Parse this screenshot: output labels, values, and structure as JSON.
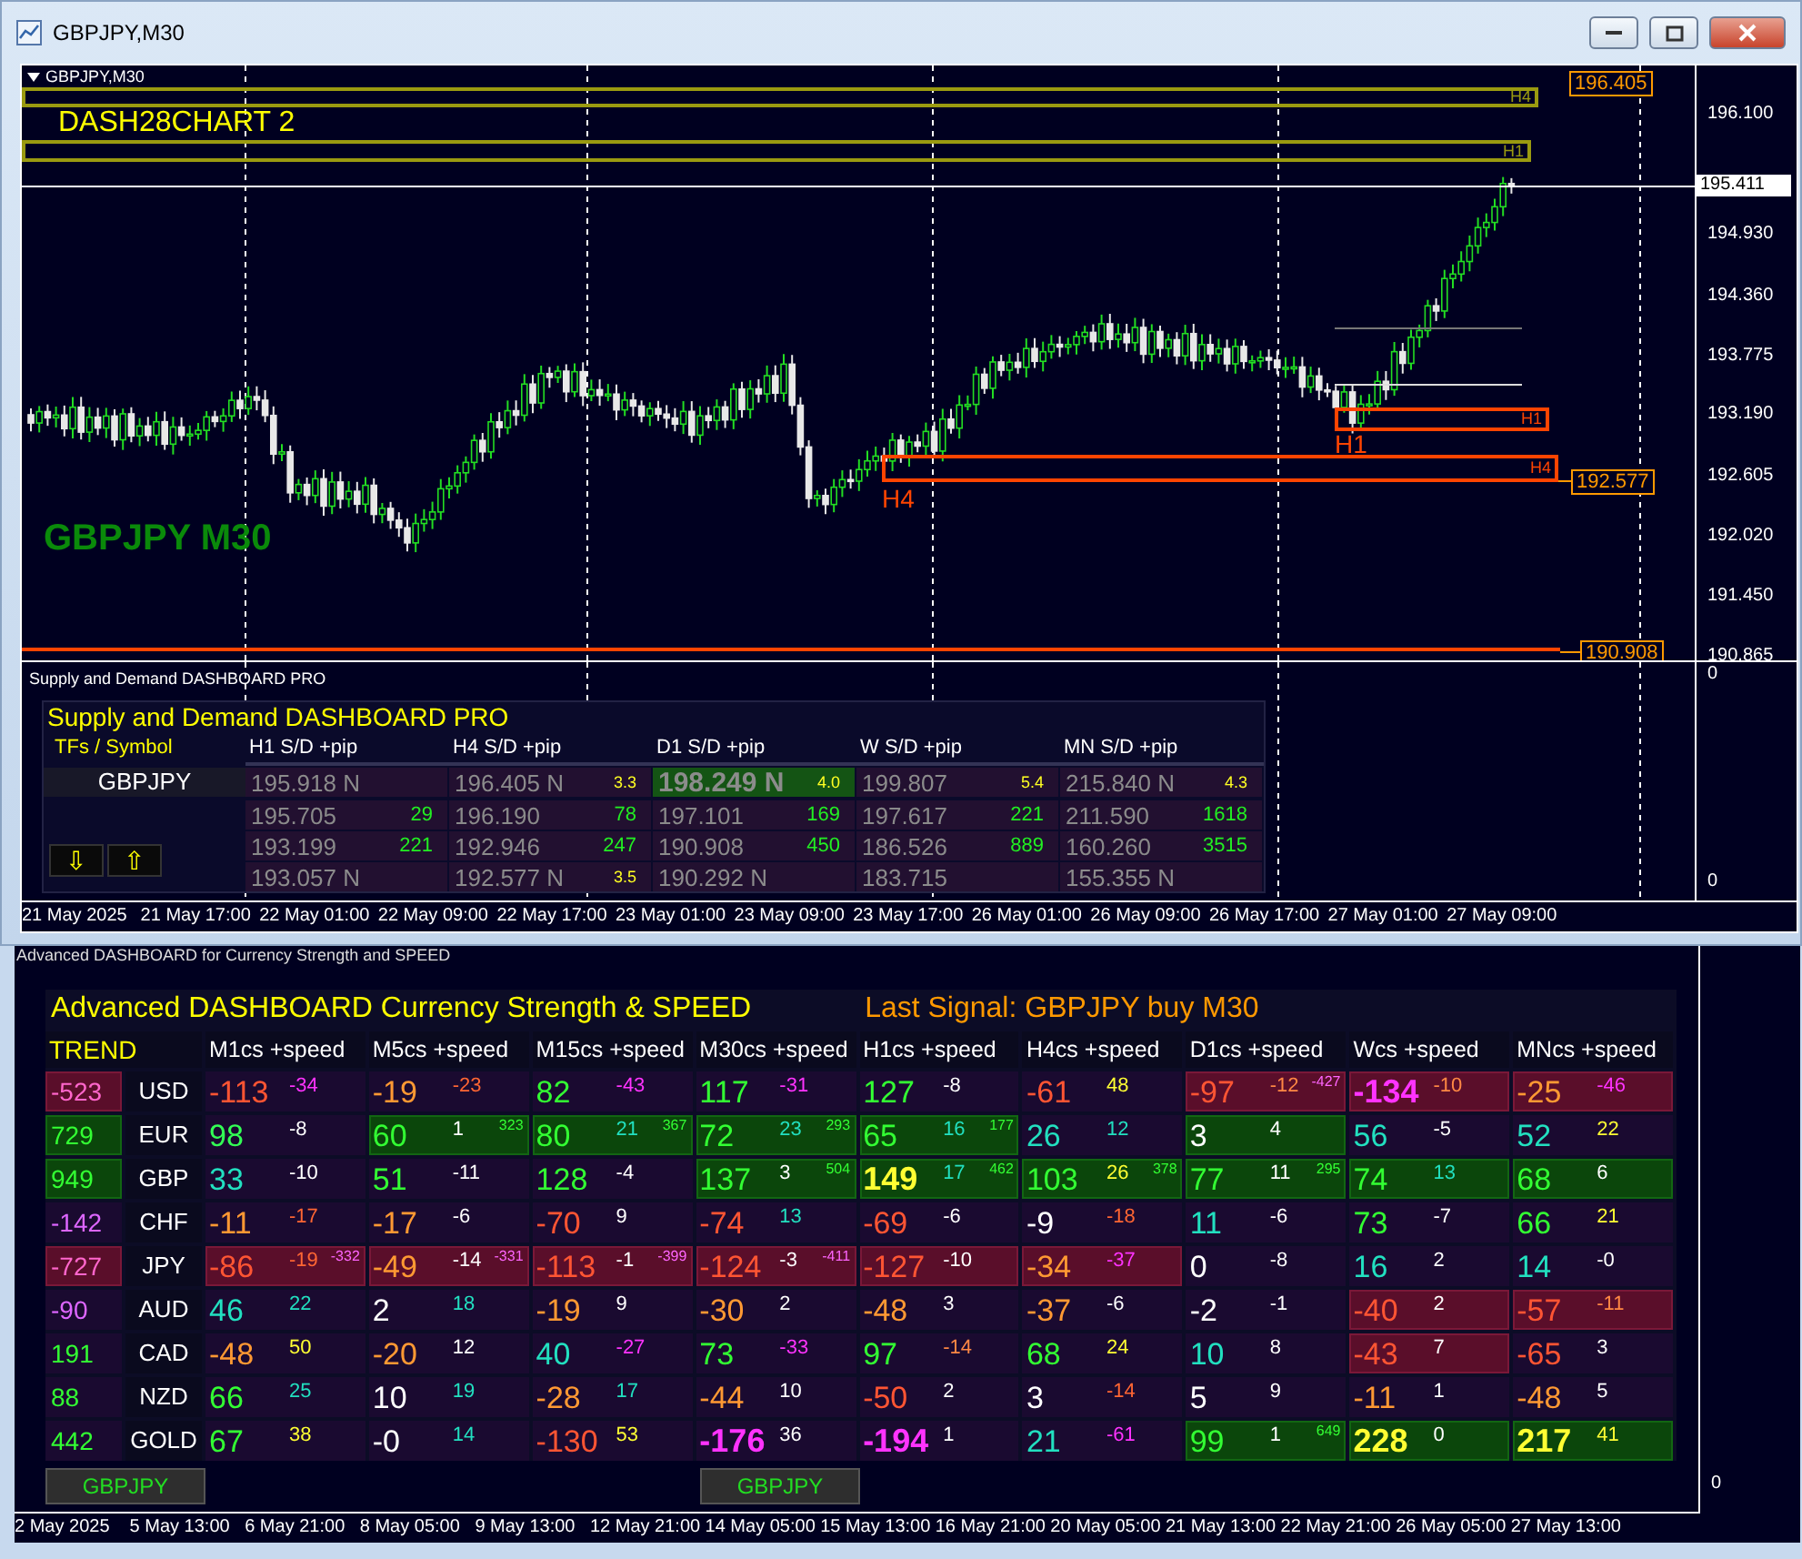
{
  "window": {
    "title": "GBPJPY,M30"
  },
  "chart": {
    "header": "GBPJPY,M30",
    "indicator_label": "DASH28CHART 2",
    "symbol_label": "GBPJPY M30",
    "zone_labels": [
      {
        "text": "H4",
        "kind": "olive"
      },
      {
        "text": "H1",
        "kind": "olive"
      },
      {
        "text": "H1",
        "kind": "orange"
      },
      {
        "text": "H4",
        "kind": "orange"
      },
      {
        "text": "H1",
        "kind": "orange-large"
      },
      {
        "text": "H4",
        "kind": "orange-large"
      }
    ],
    "price_tags": [
      "196.405",
      "192.577",
      "190.908"
    ],
    "current_price": "195.411",
    "price_axis": [
      "196.100",
      "194.930",
      "194.360",
      "193.775",
      "193.190",
      "192.605",
      "192.020",
      "191.450",
      "190.865"
    ],
    "subpane_axis": [
      "0",
      "0"
    ],
    "time_axis": [
      "21 May 2025",
      "21 May 17:00",
      "22 May 01:00",
      "22 May 09:00",
      "22 May 17:00",
      "23 May 01:00",
      "23 May 09:00",
      "23 May 17:00",
      "26 May 01:00",
      "26 May 09:00",
      "26 May 17:00",
      "27 May 01:00",
      "27 May 09:00"
    ]
  },
  "sd_dashboard": {
    "pane_title": "Supply and Demand DASHBOARD PRO",
    "title": "Supply and Demand DASHBOARD PRO",
    "symbol_header": "TFs / Symbol",
    "symbol": "GBPJPY",
    "arrows": [
      "⇩",
      "⇧"
    ],
    "columns": [
      "H1 S/D +pip",
      "H4 S/D +pip",
      "D1 S/D +pip",
      "W S/D +pip",
      "MN S/D +pip"
    ],
    "rows": [
      [
        {
          "price": "195.918 N",
          "kind": "level",
          "highlighted": false
        },
        {
          "price": "196.405 N",
          "note": "3.3",
          "kind": "level",
          "highlighted": false
        },
        {
          "price": "198.249 N",
          "note": "4.0",
          "kind": "level",
          "highlighted": true
        },
        {
          "price": "199.807",
          "note": "5.4",
          "kind": "level",
          "highlighted": false
        },
        {
          "price": "215.840 N",
          "note": "4.3",
          "kind": "level",
          "highlighted": false
        }
      ],
      [
        {
          "price": "195.705",
          "note": "29",
          "kind": "pips",
          "highlighted": false
        },
        {
          "price": "196.190",
          "note": "78",
          "kind": "pips",
          "highlighted": false
        },
        {
          "price": "197.101",
          "note": "169",
          "kind": "pips",
          "highlighted": false
        },
        {
          "price": "197.617",
          "note": "221",
          "kind": "pips",
          "highlighted": false
        },
        {
          "price": "211.590",
          "note": "1618",
          "kind": "pips",
          "highlighted": false
        }
      ],
      [
        {
          "price": "193.199",
          "note": "221",
          "kind": "pips",
          "highlighted": false
        },
        {
          "price": "192.946",
          "note": "247",
          "kind": "pips",
          "highlighted": false
        },
        {
          "price": "190.908",
          "note": "450",
          "kind": "pips",
          "highlighted": false
        },
        {
          "price": "186.526",
          "note": "889",
          "kind": "pips",
          "highlighted": false
        },
        {
          "price": "160.260",
          "note": "3515",
          "kind": "pips",
          "highlighted": false
        }
      ],
      [
        {
          "price": "193.057 N",
          "kind": "level",
          "highlighted": false
        },
        {
          "price": "192.577 N",
          "note": "3.5",
          "kind": "level",
          "highlighted": false
        },
        {
          "price": "190.292 N",
          "kind": "level",
          "highlighted": false
        },
        {
          "price": "183.715",
          "kind": "level",
          "highlighted": false
        },
        {
          "price": "155.355 N",
          "kind": "level",
          "highlighted": false
        }
      ]
    ]
  },
  "currency": {
    "pane_title": "Advanced DASHBOARD for Currency Strength and SPEED",
    "title": "Advanced  DASHBOARD Currency Strength & SPEED",
    "last_signal": "Last Signal: GBPJPY buy M30",
    "trend_header": "TREND",
    "columns": [
      "M1cs +speed",
      "M5cs +speed",
      "M15cs +speed",
      "M30cs +speed",
      "H1cs +speed",
      "H4cs +speed",
      "D1cs +speed",
      "Wcs +speed",
      "MNcs +speed"
    ],
    "rows": [
      {
        "kind": "down",
        "trend": {
          "text": "-523",
          "color": "#ff66cc"
        },
        "currency": "USD",
        "cells": [
          {
            "kind": "none",
            "value": {
              "text": "-113",
              "color": "#ff5533",
              "kind": "plain"
            },
            "speed": {
              "text": "-34",
              "color": "#ff33ff"
            }
          },
          {
            "kind": "none",
            "value": {
              "text": "-19",
              "color": "#ff9933",
              "kind": "plain"
            },
            "speed": {
              "text": "-23",
              "color": "#ff6633"
            }
          },
          {
            "kind": "none",
            "value": {
              "text": "82",
              "color": "#33ff33",
              "kind": "plain"
            },
            "speed": {
              "text": "-43",
              "color": "#ff33ff"
            }
          },
          {
            "kind": "none",
            "value": {
              "text": "117",
              "color": "#33ff33",
              "kind": "plain"
            },
            "speed": {
              "text": "-31",
              "color": "#ff33ff"
            }
          },
          {
            "kind": "none",
            "value": {
              "text": "127",
              "color": "#33ff33",
              "kind": "plain"
            },
            "speed": {
              "text": "-8",
              "color": "#ffffff"
            }
          },
          {
            "kind": "none",
            "value": {
              "text": "-61",
              "color": "#ff5533",
              "kind": "plain"
            },
            "speed": {
              "text": "48",
              "color": "#ffff33"
            }
          },
          {
            "kind": "down",
            "value": {
              "text": "-97",
              "color": "#ff5533",
              "kind": "plain"
            },
            "speed": {
              "text": "-12",
              "color": "#ff8844"
            },
            "extra": {
              "text": "-427",
              "color": "#ff66ff"
            }
          },
          {
            "kind": "down",
            "value": {
              "text": "-134",
              "color": "#ff33ff",
              "kind": "bold"
            },
            "speed": {
              "text": "-10",
              "color": "#ff8844"
            }
          },
          {
            "kind": "down",
            "value": {
              "text": "-25",
              "color": "#ff9933",
              "kind": "plain"
            },
            "speed": {
              "text": "-46",
              "color": "#ff33ff"
            }
          }
        ]
      },
      {
        "kind": "up",
        "trend": {
          "text": "729",
          "color": "#33ff33"
        },
        "currency": "EUR",
        "cells": [
          {
            "kind": "none",
            "value": {
              "text": "98",
              "color": "#33ff55",
              "kind": "plain"
            },
            "speed": {
              "text": "-8",
              "color": "#ffffff"
            }
          },
          {
            "kind": "up",
            "value": {
              "text": "60",
              "color": "#33ff33",
              "kind": "plain"
            },
            "speed": {
              "text": "1",
              "color": "#ffffff"
            },
            "extra": {
              "text": "323",
              "color": "#33ff33"
            }
          },
          {
            "kind": "up",
            "value": {
              "text": "80",
              "color": "#33ff33",
              "kind": "plain"
            },
            "speed": {
              "text": "21",
              "color": "#22e0c0"
            },
            "extra": {
              "text": "367",
              "color": "#33ff33"
            }
          },
          {
            "kind": "up",
            "value": {
              "text": "72",
              "color": "#33ff33",
              "kind": "plain"
            },
            "speed": {
              "text": "23",
              "color": "#22e0c0"
            },
            "extra": {
              "text": "293",
              "color": "#33ff33"
            }
          },
          {
            "kind": "up",
            "value": {
              "text": "65",
              "color": "#33ff33",
              "kind": "plain"
            },
            "speed": {
              "text": "16",
              "color": "#22e0c0"
            },
            "extra": {
              "text": "177",
              "color": "#33ff33"
            }
          },
          {
            "kind": "none",
            "value": {
              "text": "26",
              "color": "#22e0c0",
              "kind": "plain"
            },
            "speed": {
              "text": "12",
              "color": "#22e0c0"
            }
          },
          {
            "kind": "up",
            "value": {
              "text": "3",
              "color": "#ffffff",
              "kind": "plain"
            },
            "speed": {
              "text": "4",
              "color": "#ffffff"
            }
          },
          {
            "kind": "none",
            "value": {
              "text": "56",
              "color": "#22e0c0",
              "kind": "plain"
            },
            "speed": {
              "text": "-5",
              "color": "#ffffff"
            }
          },
          {
            "kind": "none",
            "value": {
              "text": "52",
              "color": "#22e0c0",
              "kind": "plain"
            },
            "speed": {
              "text": "22",
              "color": "#ffff33"
            }
          }
        ]
      },
      {
        "kind": "up",
        "trend": {
          "text": "949",
          "color": "#33ff33"
        },
        "currency": "GBP",
        "cells": [
          {
            "kind": "none",
            "value": {
              "text": "33",
              "color": "#22e0c0",
              "kind": "plain"
            },
            "speed": {
              "text": "-10",
              "color": "#ffffff"
            }
          },
          {
            "kind": "none",
            "value": {
              "text": "51",
              "color": "#33ff33",
              "kind": "plain"
            },
            "speed": {
              "text": "-11",
              "color": "#ffffff"
            }
          },
          {
            "kind": "none",
            "value": {
              "text": "128",
              "color": "#33ff33",
              "kind": "plain"
            },
            "speed": {
              "text": "-4",
              "color": "#ffffff"
            }
          },
          {
            "kind": "up",
            "value": {
              "text": "137",
              "color": "#33ff33",
              "kind": "plain"
            },
            "speed": {
              "text": "3",
              "color": "#ffffff"
            },
            "extra": {
              "text": "504",
              "color": "#33ff33"
            }
          },
          {
            "kind": "up",
            "value": {
              "text": "149",
              "color": "#ffff33",
              "kind": "bold"
            },
            "speed": {
              "text": "17",
              "color": "#22e0c0"
            },
            "extra": {
              "text": "462",
              "color": "#33ff33"
            }
          },
          {
            "kind": "up",
            "value": {
              "text": "103",
              "color": "#33ff33",
              "kind": "plain"
            },
            "speed": {
              "text": "26",
              "color": "#ffff33"
            },
            "extra": {
              "text": "378",
              "color": "#33ff33"
            }
          },
          {
            "kind": "up",
            "value": {
              "text": "77",
              "color": "#33ff33",
              "kind": "plain"
            },
            "speed": {
              "text": "11",
              "color": "#ffffff"
            },
            "extra": {
              "text": "295",
              "color": "#33ff33"
            }
          },
          {
            "kind": "up",
            "value": {
              "text": "74",
              "color": "#33ff33",
              "kind": "plain"
            },
            "speed": {
              "text": "13",
              "color": "#22e0c0"
            }
          },
          {
            "kind": "up",
            "value": {
              "text": "68",
              "color": "#33ff33",
              "kind": "plain"
            },
            "speed": {
              "text": "6",
              "color": "#ffffff"
            }
          }
        ]
      },
      {
        "kind": "none",
        "trend": {
          "text": "-142",
          "color": "#dd66ff"
        },
        "currency": "CHF",
        "cells": [
          {
            "kind": "none",
            "value": {
              "text": "-11",
              "color": "#ff9933",
              "kind": "plain"
            },
            "speed": {
              "text": "-17",
              "color": "#ff6633"
            }
          },
          {
            "kind": "none",
            "value": {
              "text": "-17",
              "color": "#ff9933",
              "kind": "plain"
            },
            "speed": {
              "text": "-6",
              "color": "#ffffff"
            }
          },
          {
            "kind": "none",
            "value": {
              "text": "-70",
              "color": "#ff5533",
              "kind": "plain"
            },
            "speed": {
              "text": "9",
              "color": "#ffffff"
            }
          },
          {
            "kind": "none",
            "value": {
              "text": "-74",
              "color": "#ff5533",
              "kind": "plain"
            },
            "speed": {
              "text": "13",
              "color": "#22e0c0"
            }
          },
          {
            "kind": "none",
            "value": {
              "text": "-69",
              "color": "#ff5533",
              "kind": "plain"
            },
            "speed": {
              "text": "-6",
              "color": "#ffffff"
            }
          },
          {
            "kind": "none",
            "value": {
              "text": "-9",
              "color": "#ffffff",
              "kind": "plain"
            },
            "speed": {
              "text": "-18",
              "color": "#ff6633"
            }
          },
          {
            "kind": "none",
            "value": {
              "text": "11",
              "color": "#22e0c0",
              "kind": "plain"
            },
            "speed": {
              "text": "-6",
              "color": "#ffffff"
            }
          },
          {
            "kind": "none",
            "value": {
              "text": "73",
              "color": "#33ff33",
              "kind": "plain"
            },
            "speed": {
              "text": "-7",
              "color": "#ffffff"
            }
          },
          {
            "kind": "none",
            "value": {
              "text": "66",
              "color": "#33ff33",
              "kind": "plain"
            },
            "speed": {
              "text": "21",
              "color": "#ffff33"
            }
          }
        ]
      },
      {
        "kind": "down",
        "trend": {
          "text": "-727",
          "color": "#ff66cc"
        },
        "currency": "JPY",
        "cells": [
          {
            "kind": "down",
            "value": {
              "text": "-86",
              "color": "#ff5533",
              "kind": "plain"
            },
            "speed": {
              "text": "-19",
              "color": "#ff6633"
            },
            "extra": {
              "text": "-332",
              "color": "#ff66ff"
            }
          },
          {
            "kind": "down",
            "value": {
              "text": "-49",
              "color": "#ff9933",
              "kind": "plain"
            },
            "speed": {
              "text": "-14",
              "color": "#ffffff"
            },
            "extra": {
              "text": "-331",
              "color": "#ff66ff"
            }
          },
          {
            "kind": "down",
            "value": {
              "text": "-113",
              "color": "#ff5533",
              "kind": "plain"
            },
            "speed": {
              "text": "-1",
              "color": "#ffffff"
            },
            "extra": {
              "text": "-399",
              "color": "#ff66ff"
            }
          },
          {
            "kind": "down",
            "value": {
              "text": "-124",
              "color": "#ff5533",
              "kind": "plain"
            },
            "speed": {
              "text": "-3",
              "color": "#ffffff"
            },
            "extra": {
              "text": "-411",
              "color": "#ff66ff"
            }
          },
          {
            "kind": "down",
            "value": {
              "text": "-127",
              "color": "#ff5533",
              "kind": "plain"
            },
            "speed": {
              "text": "-10",
              "color": "#ffffff"
            }
          },
          {
            "kind": "down",
            "value": {
              "text": "-34",
              "color": "#ff9933",
              "kind": "plain"
            },
            "speed": {
              "text": "-37",
              "color": "#ff33ff"
            }
          },
          {
            "kind": "none",
            "value": {
              "text": "0",
              "color": "#ffffff",
              "kind": "plain"
            },
            "speed": {
              "text": "-8",
              "color": "#ffffff"
            }
          },
          {
            "kind": "none",
            "value": {
              "text": "16",
              "color": "#22e0c0",
              "kind": "plain"
            },
            "speed": {
              "text": "2",
              "color": "#ffffff"
            }
          },
          {
            "kind": "none",
            "value": {
              "text": "14",
              "color": "#22e0c0",
              "kind": "plain"
            },
            "speed": {
              "text": "-0",
              "color": "#ffffff"
            }
          }
        ]
      },
      {
        "kind": "none",
        "trend": {
          "text": "-90",
          "color": "#dd66ff"
        },
        "currency": "AUD",
        "cells": [
          {
            "kind": "none",
            "value": {
              "text": "46",
              "color": "#22e0c0",
              "kind": "plain"
            },
            "speed": {
              "text": "22",
              "color": "#22e0c0"
            }
          },
          {
            "kind": "none",
            "value": {
              "text": "2",
              "color": "#ffffff",
              "kind": "plain"
            },
            "speed": {
              "text": "18",
              "color": "#22e0c0"
            }
          },
          {
            "kind": "none",
            "value": {
              "text": "-19",
              "color": "#ff9933",
              "kind": "plain"
            },
            "speed": {
              "text": "9",
              "color": "#ffffff"
            }
          },
          {
            "kind": "none",
            "value": {
              "text": "-30",
              "color": "#ff9933",
              "kind": "plain"
            },
            "speed": {
              "text": "2",
              "color": "#ffffff"
            }
          },
          {
            "kind": "none",
            "value": {
              "text": "-48",
              "color": "#ff9933",
              "kind": "plain"
            },
            "speed": {
              "text": "3",
              "color": "#ffffff"
            }
          },
          {
            "kind": "none",
            "value": {
              "text": "-37",
              "color": "#ff9933",
              "kind": "plain"
            },
            "speed": {
              "text": "-6",
              "color": "#ffffff"
            }
          },
          {
            "kind": "none",
            "value": {
              "text": "-2",
              "color": "#ffffff",
              "kind": "plain"
            },
            "speed": {
              "text": "-1",
              "color": "#ffffff"
            }
          },
          {
            "kind": "down",
            "value": {
              "text": "-40",
              "color": "#ff5533",
              "kind": "plain"
            },
            "speed": {
              "text": "2",
              "color": "#ffffff"
            }
          },
          {
            "kind": "down",
            "value": {
              "text": "-57",
              "color": "#ff5533",
              "kind": "plain"
            },
            "speed": {
              "text": "-11",
              "color": "#ff8844"
            }
          }
        ]
      },
      {
        "kind": "none",
        "trend": {
          "text": "191",
          "color": "#33ff33"
        },
        "currency": "CAD",
        "cells": [
          {
            "kind": "none",
            "value": {
              "text": "-48",
              "color": "#ff9933",
              "kind": "plain"
            },
            "speed": {
              "text": "50",
              "color": "#ffff33"
            }
          },
          {
            "kind": "none",
            "value": {
              "text": "-20",
              "color": "#ff9933",
              "kind": "plain"
            },
            "speed": {
              "text": "12",
              "color": "#ffffff"
            }
          },
          {
            "kind": "none",
            "value": {
              "text": "40",
              "color": "#22e0c0",
              "kind": "plain"
            },
            "speed": {
              "text": "-27",
              "color": "#ff33ff"
            }
          },
          {
            "kind": "none",
            "value": {
              "text": "73",
              "color": "#33ff33",
              "kind": "plain"
            },
            "speed": {
              "text": "-33",
              "color": "#ff33ff"
            }
          },
          {
            "kind": "none",
            "value": {
              "text": "97",
              "color": "#33ff33",
              "kind": "plain"
            },
            "speed": {
              "text": "-14",
              "color": "#ff8844"
            }
          },
          {
            "kind": "none",
            "value": {
              "text": "68",
              "color": "#33ff33",
              "kind": "plain"
            },
            "speed": {
              "text": "24",
              "color": "#ffff33"
            }
          },
          {
            "kind": "none",
            "value": {
              "text": "10",
              "color": "#22e0c0",
              "kind": "plain"
            },
            "speed": {
              "text": "8",
              "color": "#ffffff"
            }
          },
          {
            "kind": "down",
            "value": {
              "text": "-43",
              "color": "#ff5533",
              "kind": "plain"
            },
            "speed": {
              "text": "7",
              "color": "#ffffff"
            }
          },
          {
            "kind": "none",
            "value": {
              "text": "-65",
              "color": "#ff5533",
              "kind": "plain"
            },
            "speed": {
              "text": "3",
              "color": "#ffffff"
            }
          }
        ]
      },
      {
        "kind": "none",
        "trend": {
          "text": "88",
          "color": "#33ff33"
        },
        "currency": "NZD",
        "cells": [
          {
            "kind": "none",
            "value": {
              "text": "66",
              "color": "#33ff33",
              "kind": "plain"
            },
            "speed": {
              "text": "25",
              "color": "#22e0c0"
            }
          },
          {
            "kind": "none",
            "value": {
              "text": "10",
              "color": "#ffffff",
              "kind": "plain"
            },
            "speed": {
              "text": "19",
              "color": "#22e0c0"
            }
          },
          {
            "kind": "none",
            "value": {
              "text": "-28",
              "color": "#ff9933",
              "kind": "plain"
            },
            "speed": {
              "text": "17",
              "color": "#22e0c0"
            }
          },
          {
            "kind": "none",
            "value": {
              "text": "-44",
              "color": "#ff9933",
              "kind": "plain"
            },
            "speed": {
              "text": "10",
              "color": "#ffffff"
            }
          },
          {
            "kind": "none",
            "value": {
              "text": "-50",
              "color": "#ff5533",
              "kind": "plain"
            },
            "speed": {
              "text": "2",
              "color": "#ffffff"
            }
          },
          {
            "kind": "none",
            "value": {
              "text": "3",
              "color": "#ffffff",
              "kind": "plain"
            },
            "speed": {
              "text": "-14",
              "color": "#ff6633"
            }
          },
          {
            "kind": "none",
            "value": {
              "text": "5",
              "color": "#ffffff",
              "kind": "plain"
            },
            "speed": {
              "text": "9",
              "color": "#ffffff"
            }
          },
          {
            "kind": "none",
            "value": {
              "text": "-11",
              "color": "#ff9933",
              "kind": "plain"
            },
            "speed": {
              "text": "1",
              "color": "#ffffff"
            }
          },
          {
            "kind": "none",
            "value": {
              "text": "-48",
              "color": "#ff9933",
              "kind": "plain"
            },
            "speed": {
              "text": "5",
              "color": "#ffffff"
            }
          }
        ]
      },
      {
        "kind": "none",
        "trend": {
          "text": "442",
          "color": "#33ff33"
        },
        "currency": "GOLD",
        "cells": [
          {
            "kind": "none",
            "value": {
              "text": "67",
              "color": "#33ff33",
              "kind": "plain"
            },
            "speed": {
              "text": "38",
              "color": "#ffff33"
            }
          },
          {
            "kind": "none",
            "value": {
              "text": "-0",
              "color": "#ffffff",
              "kind": "plain"
            },
            "speed": {
              "text": "14",
              "color": "#22e0c0"
            }
          },
          {
            "kind": "none",
            "value": {
              "text": "-130",
              "color": "#ff5533",
              "kind": "plain"
            },
            "speed": {
              "text": "53",
              "color": "#ffff33"
            }
          },
          {
            "kind": "none",
            "value": {
              "text": "-176",
              "color": "#ff33ff",
              "kind": "bold"
            },
            "speed": {
              "text": "36",
              "color": "#ffffff"
            }
          },
          {
            "kind": "none",
            "value": {
              "text": "-194",
              "color": "#ff33ff",
              "kind": "bold"
            },
            "speed": {
              "text": "1",
              "color": "#ffffff"
            }
          },
          {
            "kind": "none",
            "value": {
              "text": "21",
              "color": "#22e0c0",
              "kind": "plain"
            },
            "speed": {
              "text": "-61",
              "color": "#ff33ff"
            }
          },
          {
            "kind": "up",
            "value": {
              "text": "99",
              "color": "#33ff33",
              "kind": "plain"
            },
            "speed": {
              "text": "1",
              "color": "#ffffff"
            },
            "extra": {
              "text": "649",
              "color": "#33ff33"
            }
          },
          {
            "kind": "up",
            "value": {
              "text": "228",
              "color": "#ffff33",
              "kind": "bold"
            },
            "speed": {
              "text": "0",
              "color": "#ffffff"
            }
          },
          {
            "kind": "up",
            "value": {
              "text": "217",
              "color": "#ffff33",
              "kind": "bold"
            },
            "speed": {
              "text": "41",
              "color": "#ffff33"
            }
          }
        ]
      }
    ],
    "buttons": [
      "GBPJPY",
      "GBPJPY"
    ],
    "axis": [
      "0"
    ],
    "time_axis": [
      "2 May 2025",
      "5 May 13:00",
      "6 May 21:00",
      "8 May 05:00",
      "9 May 13:00",
      "12 May 21:00",
      "14 May 05:00",
      "15 May 13:00",
      "16 May 21:00",
      "20 May 05:00",
      "21 May 13:00",
      "22 May 21:00",
      "26 May 05:00",
      "27 May 13:00"
    ]
  }
}
